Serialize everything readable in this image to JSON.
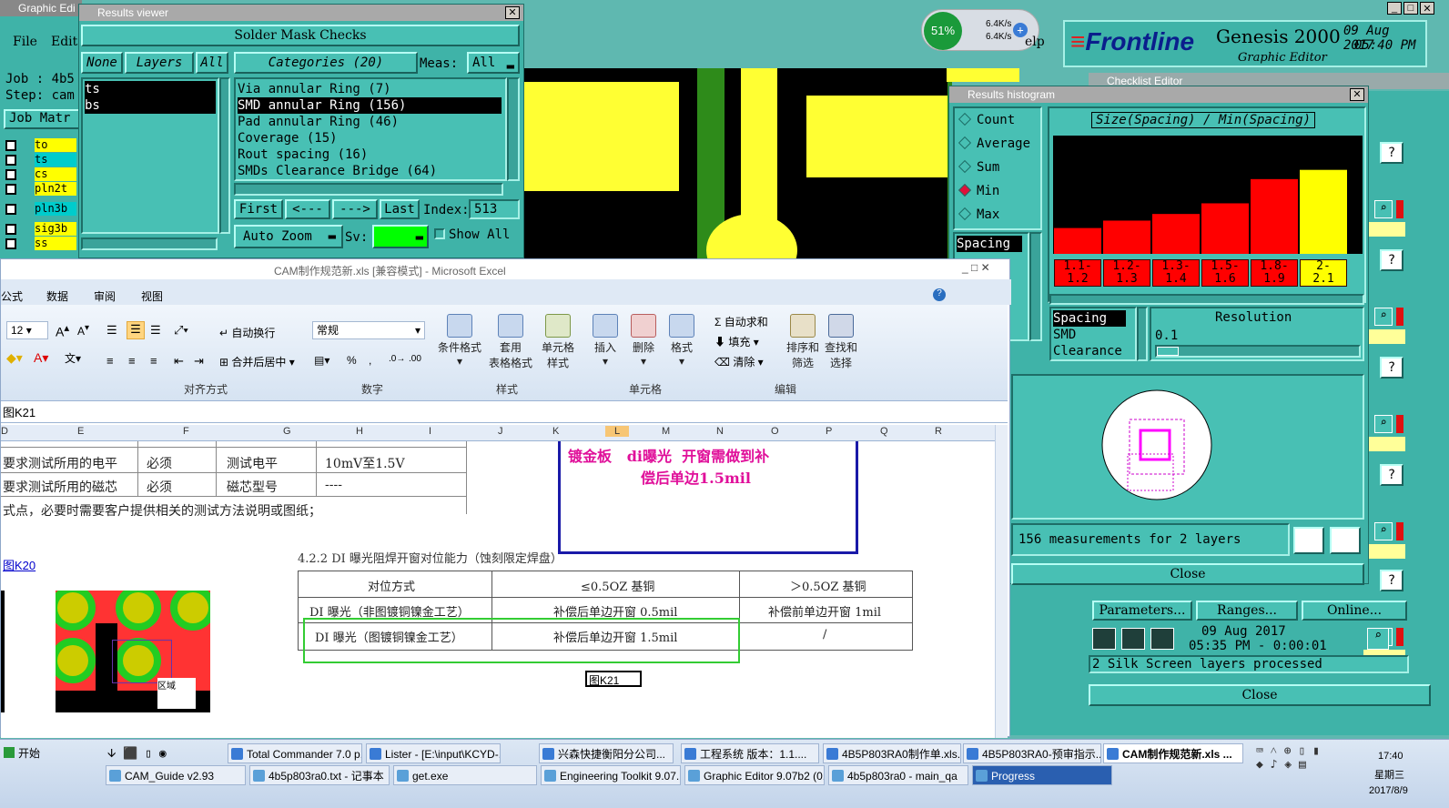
{
  "graphic_editor": {
    "title": "Graphic Edi",
    "menu_file": "File",
    "menu_edit": "Edit",
    "job": "Job : 4b5",
    "step": "Step: cam",
    "job_matrix": "Job Matr",
    "layers": [
      "to",
      "ts",
      "cs",
      "pln2t",
      "pln3b",
      "sig3b",
      "ss"
    ]
  },
  "results_viewer": {
    "title": "Results viewer",
    "header": "Solder Mask Checks",
    "none": "None",
    "layers_btn": "Layers",
    "all": "All",
    "layer_list": [
      "ts",
      "bs"
    ],
    "categories": "Categories (20)",
    "meas_label": "Meas:",
    "meas_value": "All",
    "category_items": [
      "Via annular Ring (7)",
      "SMD annular Ring (156)",
      "Pad annular Ring (46)",
      "Coverage (15)",
      "Rout spacing (16)",
      "SMDs Clearance Bridge (64)"
    ],
    "selected_index": 1,
    "first": "First",
    "prev": "<---",
    "next": "--->",
    "last": "Last",
    "index_label": "Index:",
    "index_value": "513",
    "auto_zoom": "Auto Zoom",
    "sv_label": "Sv:",
    "show_all": "Show All"
  },
  "netspeed": {
    "percent": "51%",
    "up": "6.4K/s",
    "down": "6.4K/s",
    "help": "elp"
  },
  "frontline": {
    "logo": "Frontline",
    "product": "Genesis 2000",
    "subtitle": "Graphic Editor",
    "date": "09 Aug 2017",
    "time": "05:40 PM",
    "checklist_title": "Checklist Editor"
  },
  "histogram": {
    "title": "Results histogram",
    "modes": [
      "Count",
      "Average",
      "Sum",
      "Min",
      "Max"
    ],
    "selected_mode": "Min",
    "chart_title": "Size(Spacing) / Min(Spacing)",
    "list1": [
      "Spacing"
    ],
    "list2": [
      "Spacing",
      "SMD",
      "Clearance"
    ],
    "resolution_label": "Resolution",
    "resolution_value": "0.1",
    "measurements": "156 measurements for 2 layers",
    "close": "Close",
    "chart_data": {
      "type": "bar",
      "categories": [
        "1.1-1.2",
        "1.2-1.3",
        "1.3-1.4",
        "1.5-1.6",
        "1.8-1.9",
        "2-2.1"
      ],
      "values": [
        1.169,
        1.275,
        1.37,
        1.522,
        1.868,
        2
      ],
      "labels": [
        "1.169",
        "1.275",
        "1.37",
        "1.522",
        "1.868",
        "2"
      ],
      "cat_line1": [
        "1.1-",
        "1.2-",
        "1.3-",
        "1.5-",
        "1.8-",
        "2-"
      ],
      "cat_line2": [
        "1.2",
        "1.3",
        "1.4",
        "1.6",
        "1.9",
        "2.1"
      ],
      "colors": [
        "#ff0000",
        "#ff0000",
        "#ff0000",
        "#ff0000",
        "#ff0000",
        "#ffff00"
      ],
      "selected_index": 5,
      "ylim": [
        0.8,
        2.1
      ]
    }
  },
  "checklist": {
    "params": "Parameters...",
    "ranges": "Ranges...",
    "online": "Online...",
    "date": "09 Aug 2017",
    "time": "05:35 PM - 0:00:01",
    "status": "2 Silk Screen layers processed",
    "close": "Close",
    "q": "?"
  },
  "excel": {
    "title": "CAM制作规范新.xls  [兼容模式] - Microsoft Excel",
    "tabs": [
      "公式",
      "数据",
      "审阅",
      "视图"
    ],
    "font_size": "12",
    "wrap": "自动换行",
    "merge": "合并后居中",
    "number_format": "常规",
    "cond_format": "条件格式",
    "table_format": "套用\n表格格式",
    "cell_style": "单元格\n样式",
    "insert": "插入",
    "delete": "删除",
    "format": "格式",
    "autosum": "Σ 自动求和",
    "fill": "填充",
    "clear": "清除",
    "sort": "排序和\n筛选",
    "find": "查找和\n选择",
    "groups": [
      "对齐方式",
      "数字",
      "样式",
      "单元格",
      "编辑"
    ],
    "formula_text": "图K21",
    "columns": [
      "D",
      "E",
      "F",
      "G",
      "H",
      "I",
      "J",
      "K",
      "L",
      "M",
      "N",
      "O",
      "P",
      "Q",
      "R"
    ],
    "rows": [
      [
        "要求测试所用的电平",
        "必须",
        "测试电平",
        "10mV至1.5V"
      ],
      [
        "要求测试所用的磁芯",
        "必须",
        "磁芯型号",
        "----"
      ]
    ],
    "note_line": "式点，必要时需要客户提供相关的测试方法说明或图纸；",
    "link_k20": "图K20",
    "redbox_line1": "镀金板   di曝光  开窗需做到补",
    "redbox_line2": "偿后单边1.5mil",
    "section_title": "4.2.2 DI 曝光阻焊开窗对位能力（蚀刻限定焊盘）",
    "table_head": [
      "对位方式",
      "≤0.5OZ 基铜",
      "＞0.5OZ 基铜"
    ],
    "table_r1": [
      "DI 曝光（非图镀铜镍金工艺）",
      "补偿后单边开窗 0.5mil",
      "补偿前单边开窗 1mil"
    ],
    "table_r2": [
      "DI 曝光（图镀铜镍金工艺）",
      "补偿后单边开窗 1.5mil",
      "/"
    ],
    "label_k21": "图K21",
    "image_label": "区域"
  },
  "taskbar": {
    "start": "开始",
    "row1": [
      "Total Commander 7.0 p...",
      "Lister - [E:\\input\\KCYD-...",
      "兴森快捷衡阳分公司...",
      "工程系统  版本：1.1....",
      "4B5P803RA0制作单.xls...",
      "4B5P803RA0-预审指示...",
      "CAM制作规范新.xls ..."
    ],
    "row2": [
      "CAM_Guide v2.93",
      "4b5p803ra0.txt - 记事本",
      "get.exe",
      "Engineering Toolkit 9.07...",
      "Graphic Editor 9.07b2 (0...",
      "4b5p803ra0 - main_qa",
      "Progress"
    ],
    "clock": "17:40",
    "weekday": "星期三",
    "date": "2017/8/9"
  }
}
